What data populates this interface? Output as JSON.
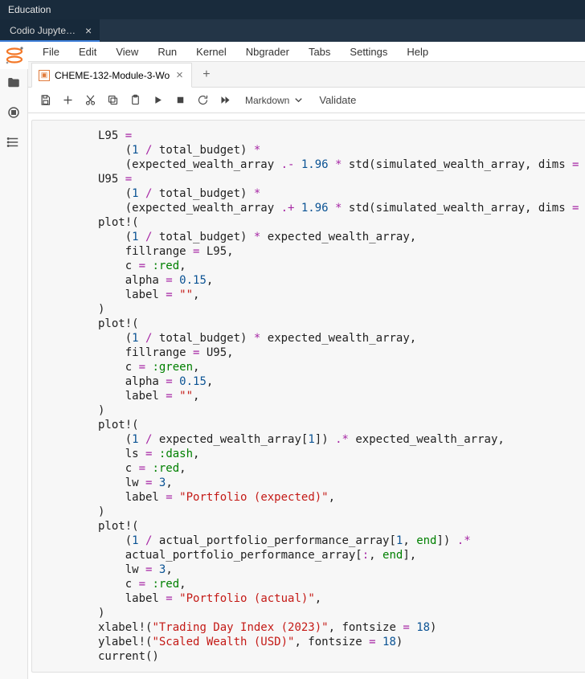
{
  "topbar": {
    "title": "Education"
  },
  "browserTab": {
    "label": "Codio Jupyte…"
  },
  "menu": {
    "file": "File",
    "edit": "Edit",
    "view": "View",
    "run": "Run",
    "kernel": "Kernel",
    "nbgrader": "Nbgrader",
    "tabs": "Tabs",
    "settings": "Settings",
    "help": "Help"
  },
  "doc": {
    "tabLabel": "CHEME-132-Module-3-Wo"
  },
  "toolbar": {
    "celltype": "Markdown",
    "validate": "Validate"
  }
}
